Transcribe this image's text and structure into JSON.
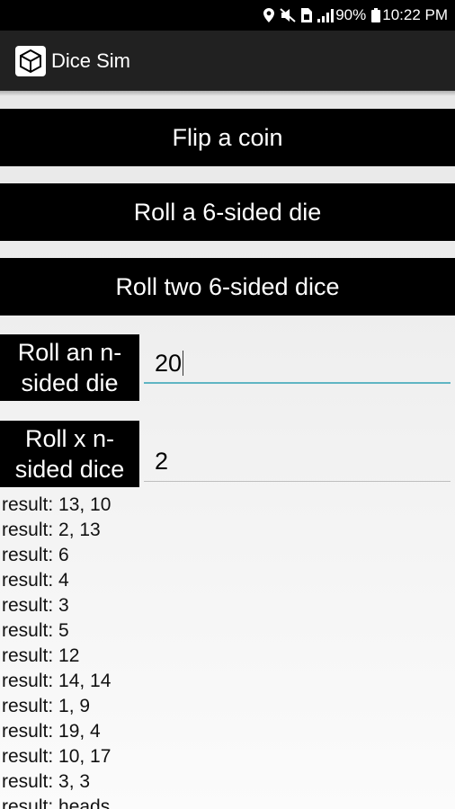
{
  "status_bar": {
    "battery": "90%",
    "time": "10:22 PM"
  },
  "app_bar": {
    "title": "Dice Sim"
  },
  "buttons": {
    "flip_coin": "Flip a coin",
    "roll_one": "Roll a 6-sided die",
    "roll_two": "Roll two 6-sided dice"
  },
  "n_sided": {
    "label_line1": "Roll an n-",
    "label_line2": "sided die",
    "value": "20"
  },
  "x_n_sided": {
    "label_line1": "Roll x n-",
    "label_line2": "sided dice",
    "value": "2"
  },
  "results": [
    "result: 13, 10",
    "result: 2, 13",
    "result: 6",
    "result: 4",
    "result: 3",
    "result: 5",
    "result: 12",
    "result: 14, 14",
    "result: 1, 9",
    "result: 19, 4",
    "result: 10, 17",
    "result: 3, 3",
    "result: heads"
  ]
}
